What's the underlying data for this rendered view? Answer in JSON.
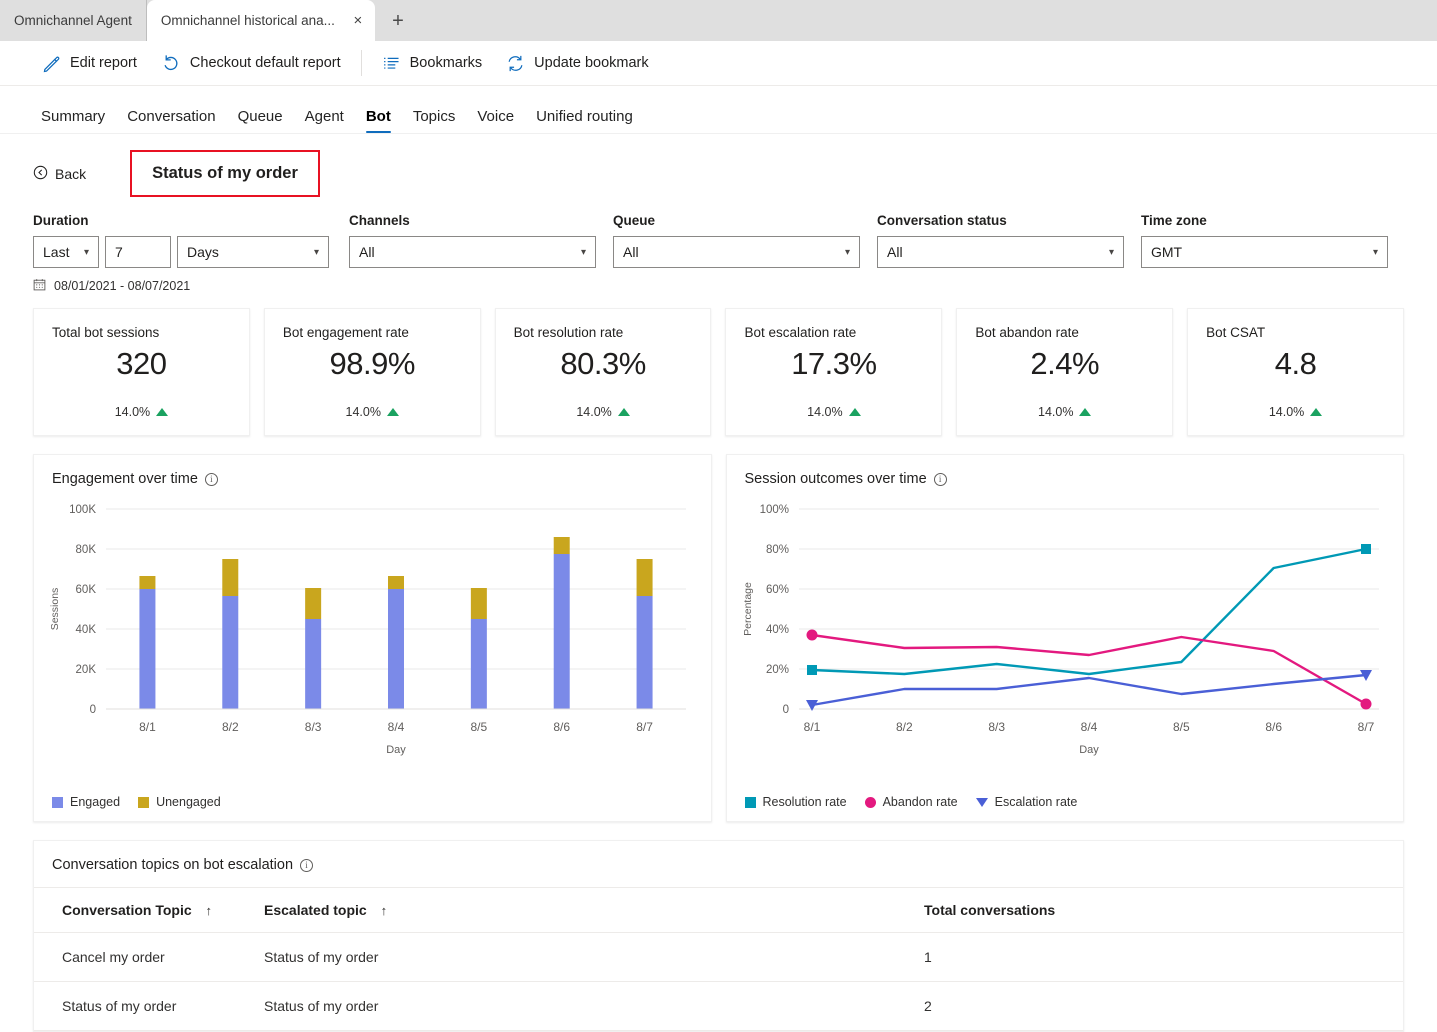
{
  "browser": {
    "tabs": [
      {
        "title": "Omnichannel Agent",
        "active": false
      },
      {
        "title": "Omnichannel historical ana...",
        "active": true
      }
    ],
    "close_glyph": "×",
    "newtab_glyph": "+"
  },
  "commandbar": {
    "items": [
      {
        "label": "Edit report",
        "icon": "pencil-icon"
      },
      {
        "label": "Checkout default report",
        "icon": "undo-icon"
      },
      {
        "label": "Bookmarks",
        "icon": "list-icon"
      },
      {
        "label": "Update bookmark",
        "icon": "refresh-icon"
      }
    ]
  },
  "nav": {
    "tabs": [
      {
        "label": "Summary",
        "selected": false
      },
      {
        "label": "Conversation",
        "selected": false
      },
      {
        "label": "Queue",
        "selected": false
      },
      {
        "label": "Agent",
        "selected": false
      },
      {
        "label": "Bot",
        "selected": true
      },
      {
        "label": "Topics",
        "selected": false
      },
      {
        "label": "Voice",
        "selected": false
      },
      {
        "label": "Unified routing",
        "selected": false
      }
    ]
  },
  "header": {
    "back_label": "Back",
    "back_icon": "circle-chevron-left-icon",
    "page_title": "Status of my order",
    "highlight_color": "#e81123"
  },
  "filters": {
    "duration": {
      "label": "Duration",
      "operator": "Last",
      "amount": "7",
      "unit": "Days"
    },
    "channels": {
      "label": "Channels",
      "value": "All"
    },
    "queue": {
      "label": "Queue",
      "value": "All"
    },
    "conversation_status": {
      "label": "Conversation status",
      "value": "All"
    },
    "time_zone": {
      "label": "Time zone",
      "value": "GMT"
    },
    "date_range": "08/01/2021 - 08/07/2021",
    "calendar_icon": "calendar-icon"
  },
  "kpis": [
    {
      "title": "Total bot sessions",
      "value": "320",
      "delta": "14.0%",
      "trend": "up"
    },
    {
      "title": "Bot engagement rate",
      "value": "98.9%",
      "delta": "14.0%",
      "trend": "up"
    },
    {
      "title": "Bot resolution rate",
      "value": "80.3%",
      "delta": "14.0%",
      "trend": "up"
    },
    {
      "title": "Bot escalation rate",
      "value": "17.3%",
      "delta": "14.0%",
      "trend": "up"
    },
    {
      "title": "Bot abandon rate",
      "value": "2.4%",
      "delta": "14.0%",
      "trend": "up"
    },
    {
      "title": "Bot CSAT",
      "value": "4.8",
      "delta": "14.0%",
      "trend": "up"
    }
  ],
  "chart_data": [
    {
      "type": "bar",
      "id": "engagement-over-time",
      "title": "Engagement over time",
      "stacked": true,
      "categories": [
        "8/1",
        "8/2",
        "8/3",
        "8/4",
        "8/5",
        "8/6",
        "8/7"
      ],
      "series": [
        {
          "name": "Engaged",
          "color": "#7B8AE8",
          "values": [
            60000,
            56500,
            45000,
            60000,
            45000,
            77500,
            56500
          ]
        },
        {
          "name": "Unengaged",
          "color": "#C9A61E",
          "values": [
            6500,
            18500,
            15500,
            6500,
            15500,
            8500,
            18500
          ]
        }
      ],
      "xlabel": "Day",
      "ylabel": "Sessions",
      "ylim": [
        0,
        100000
      ],
      "yticks": [
        0,
        20000,
        40000,
        60000,
        80000,
        100000
      ],
      "yticklabels": [
        "0",
        "20K",
        "40K",
        "60K",
        "80K",
        "100K"
      ],
      "grid": true,
      "legend_position": "bottom-left"
    },
    {
      "type": "line",
      "id": "session-outcomes-over-time",
      "title": "Session outcomes over time",
      "x": [
        "8/1",
        "8/2",
        "8/3",
        "8/4",
        "8/5",
        "8/6",
        "8/7"
      ],
      "series": [
        {
          "name": "Resolution rate",
          "color": "#0099b5",
          "marker": "square",
          "values": [
            19.5,
            17.5,
            22.5,
            17.5,
            23.5,
            70.5,
            80.0
          ]
        },
        {
          "name": "Abandon rate",
          "color": "#e3197f",
          "marker": "circle",
          "values": [
            37.0,
            30.5,
            31.0,
            27.0,
            36.0,
            29.0,
            2.5
          ]
        },
        {
          "name": "Escalation rate",
          "color": "#4a5fd6",
          "marker": "triangle",
          "values": [
            2.0,
            10.0,
            10.0,
            15.5,
            7.5,
            12.5,
            17.0
          ]
        }
      ],
      "xlabel": "Day",
      "ylabel": "Percentage",
      "ylim": [
        0,
        100
      ],
      "yticks": [
        0,
        20,
        40,
        60,
        80,
        100
      ],
      "yticklabels": [
        "0",
        "20%",
        "40%",
        "60%",
        "80%",
        "100%"
      ],
      "grid": true,
      "legend_position": "bottom-left"
    }
  ],
  "table_panel": {
    "title": "Conversation topics on bot escalation",
    "columns": [
      {
        "label": "Conversation Topic",
        "sort": "↑"
      },
      {
        "label": "Escalated topic",
        "sort": "↑"
      },
      {
        "label": "Total conversations",
        "sort": ""
      }
    ],
    "rows": [
      {
        "topic": "Cancel my order",
        "escalated": "Status of my order",
        "total": "1"
      },
      {
        "topic": "Status of my order",
        "escalated": "Status of my order",
        "total": "2"
      }
    ]
  }
}
